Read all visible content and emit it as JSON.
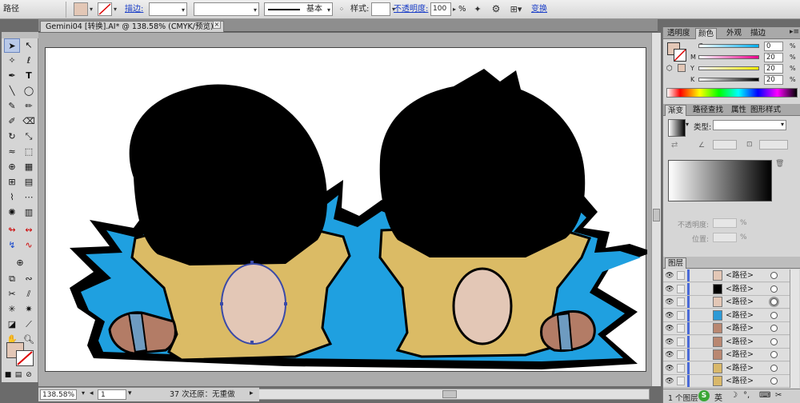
{
  "control_bar": {
    "object_type": "路径",
    "fill_color": "#e3c7b6",
    "stroke_label": "描边:",
    "style_label": "样式:",
    "opacity_label": "不透明度:",
    "opacity_value": "100",
    "opacity_unit": "%",
    "brush_label": "基本",
    "transform_label": "变换"
  },
  "document_tab": {
    "title": "Gemini04 [转换].AI* @ 138.58% (CMYK/预览)",
    "close": "×"
  },
  "status": {
    "zoom": "138.58%",
    "page": "1",
    "message": "37 次还原：无重做"
  },
  "color_panel": {
    "tabs": [
      "透明度",
      "颜色",
      "外观",
      "描边"
    ],
    "active_tab": "颜色",
    "channels": [
      {
        "name": "C",
        "value": "0"
      },
      {
        "name": "M",
        "value": "20"
      },
      {
        "name": "Y",
        "value": "20"
      },
      {
        "name": "K",
        "value": "20"
      }
    ],
    "unit": "%",
    "fill_color": "#e3c7b6"
  },
  "gradient_panel": {
    "tabs": [
      "渐变",
      "路径查找",
      "属性",
      "图形样式"
    ],
    "active_tab": "渐变",
    "type_label": "类型:",
    "opacity_label": "不透明度:",
    "position_label": "位置:",
    "unit": "%"
  },
  "layers_panel": {
    "title": "图层",
    "footer": "1 个图层",
    "rows": [
      {
        "name": "<路径>",
        "thumb": "#e3c7b6"
      },
      {
        "name": "<路径>",
        "thumb": "#000000"
      },
      {
        "name": "<路径>",
        "thumb": "#e3c7b6"
      },
      {
        "name": "<路径>",
        "thumb": "#2d9ad6"
      },
      {
        "name": "<路径>",
        "thumb": "#b98771"
      },
      {
        "name": "<路径>",
        "thumb": "#b98771"
      },
      {
        "name": "<路径>",
        "thumb": "#b98771"
      },
      {
        "name": "<路径>",
        "thumb": "#d9b86a"
      },
      {
        "name": "<路径>",
        "thumb": "#d9b86a"
      }
    ]
  },
  "taskbar": {
    "ime": "英"
  },
  "colors": {
    "hair": "#000000",
    "shirt": "#dbbb65",
    "face": "#e3c7b6",
    "splash": "#1fa0e0",
    "stripe": "#6e9bc0",
    "shoe": "#b37c66"
  }
}
